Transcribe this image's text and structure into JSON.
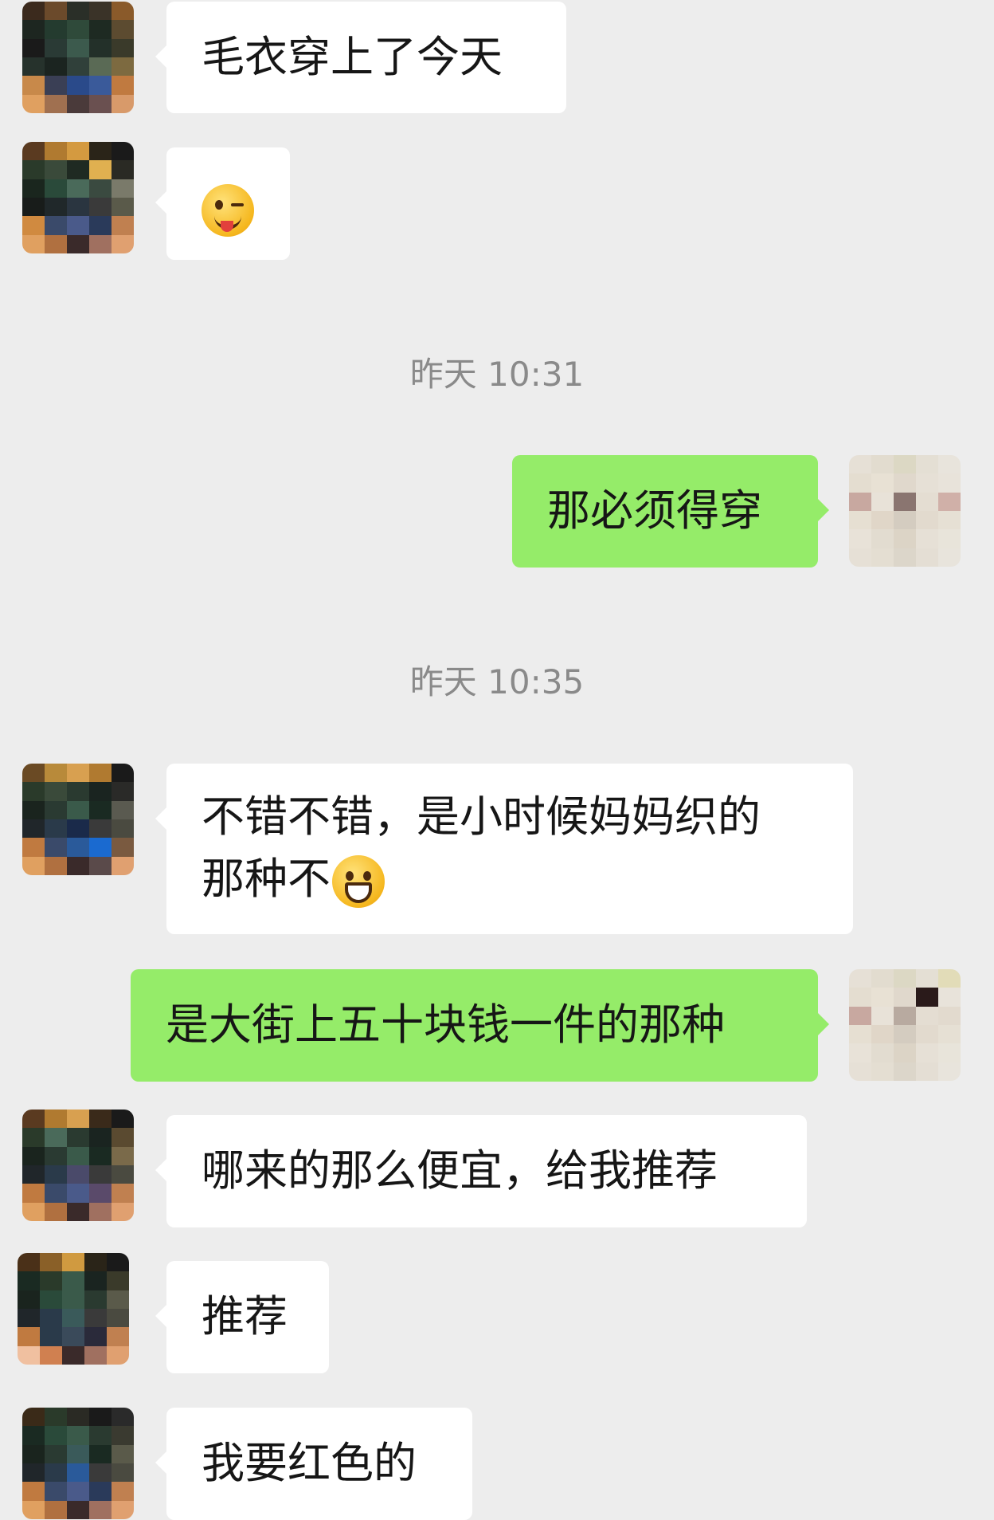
{
  "messages": [
    {
      "id": "m1",
      "side": "in",
      "text": "毛衣穿上了今天"
    },
    {
      "id": "m2",
      "side": "in",
      "emoji": "winking-face-with-tongue-emoji"
    },
    {
      "id": "t1",
      "type": "time",
      "text": "昨天 10:31"
    },
    {
      "id": "m3",
      "side": "out",
      "text": "那必须得穿"
    },
    {
      "id": "t2",
      "type": "time",
      "text": "昨天 10:35"
    },
    {
      "id": "m4",
      "side": "in",
      "line1": "不错不错，是小时候妈妈织的",
      "line2": "那种不",
      "emoji": "grinning-face-emoji"
    },
    {
      "id": "m5",
      "side": "out",
      "text": "是大街上五十块钱一件的那种"
    },
    {
      "id": "m6",
      "side": "in",
      "text": "哪来的那么便宜，给我推荐"
    },
    {
      "id": "m7",
      "side": "in",
      "text": "推荐"
    },
    {
      "id": "m8",
      "side": "in",
      "text": "我要红色的"
    }
  ],
  "colors": {
    "background": "#ededed",
    "incoming_bubble": "#ffffff",
    "outgoing_bubble": "#95ec69",
    "timestamp_text": "#8a8a8a"
  },
  "avatars": {
    "contact": "pixelated-contact-avatar",
    "self": "pixelated-self-avatar"
  }
}
